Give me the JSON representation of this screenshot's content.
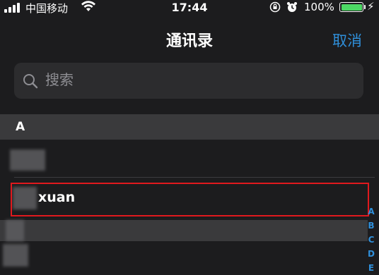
{
  "status_bar": {
    "carrier": "中国移动",
    "time": "17:44",
    "battery_percent": "100%",
    "battery_level": 1.0,
    "battery_color": "#4cd964"
  },
  "nav": {
    "title": "通讯录",
    "cancel_label": "取消",
    "accent_color": "#2f8fda"
  },
  "search": {
    "placeholder": "搜索"
  },
  "contacts": {
    "section_letter": "A",
    "selected_contact": "xuan"
  },
  "index_letters": [
    "A",
    "B",
    "C",
    "D",
    "E"
  ]
}
